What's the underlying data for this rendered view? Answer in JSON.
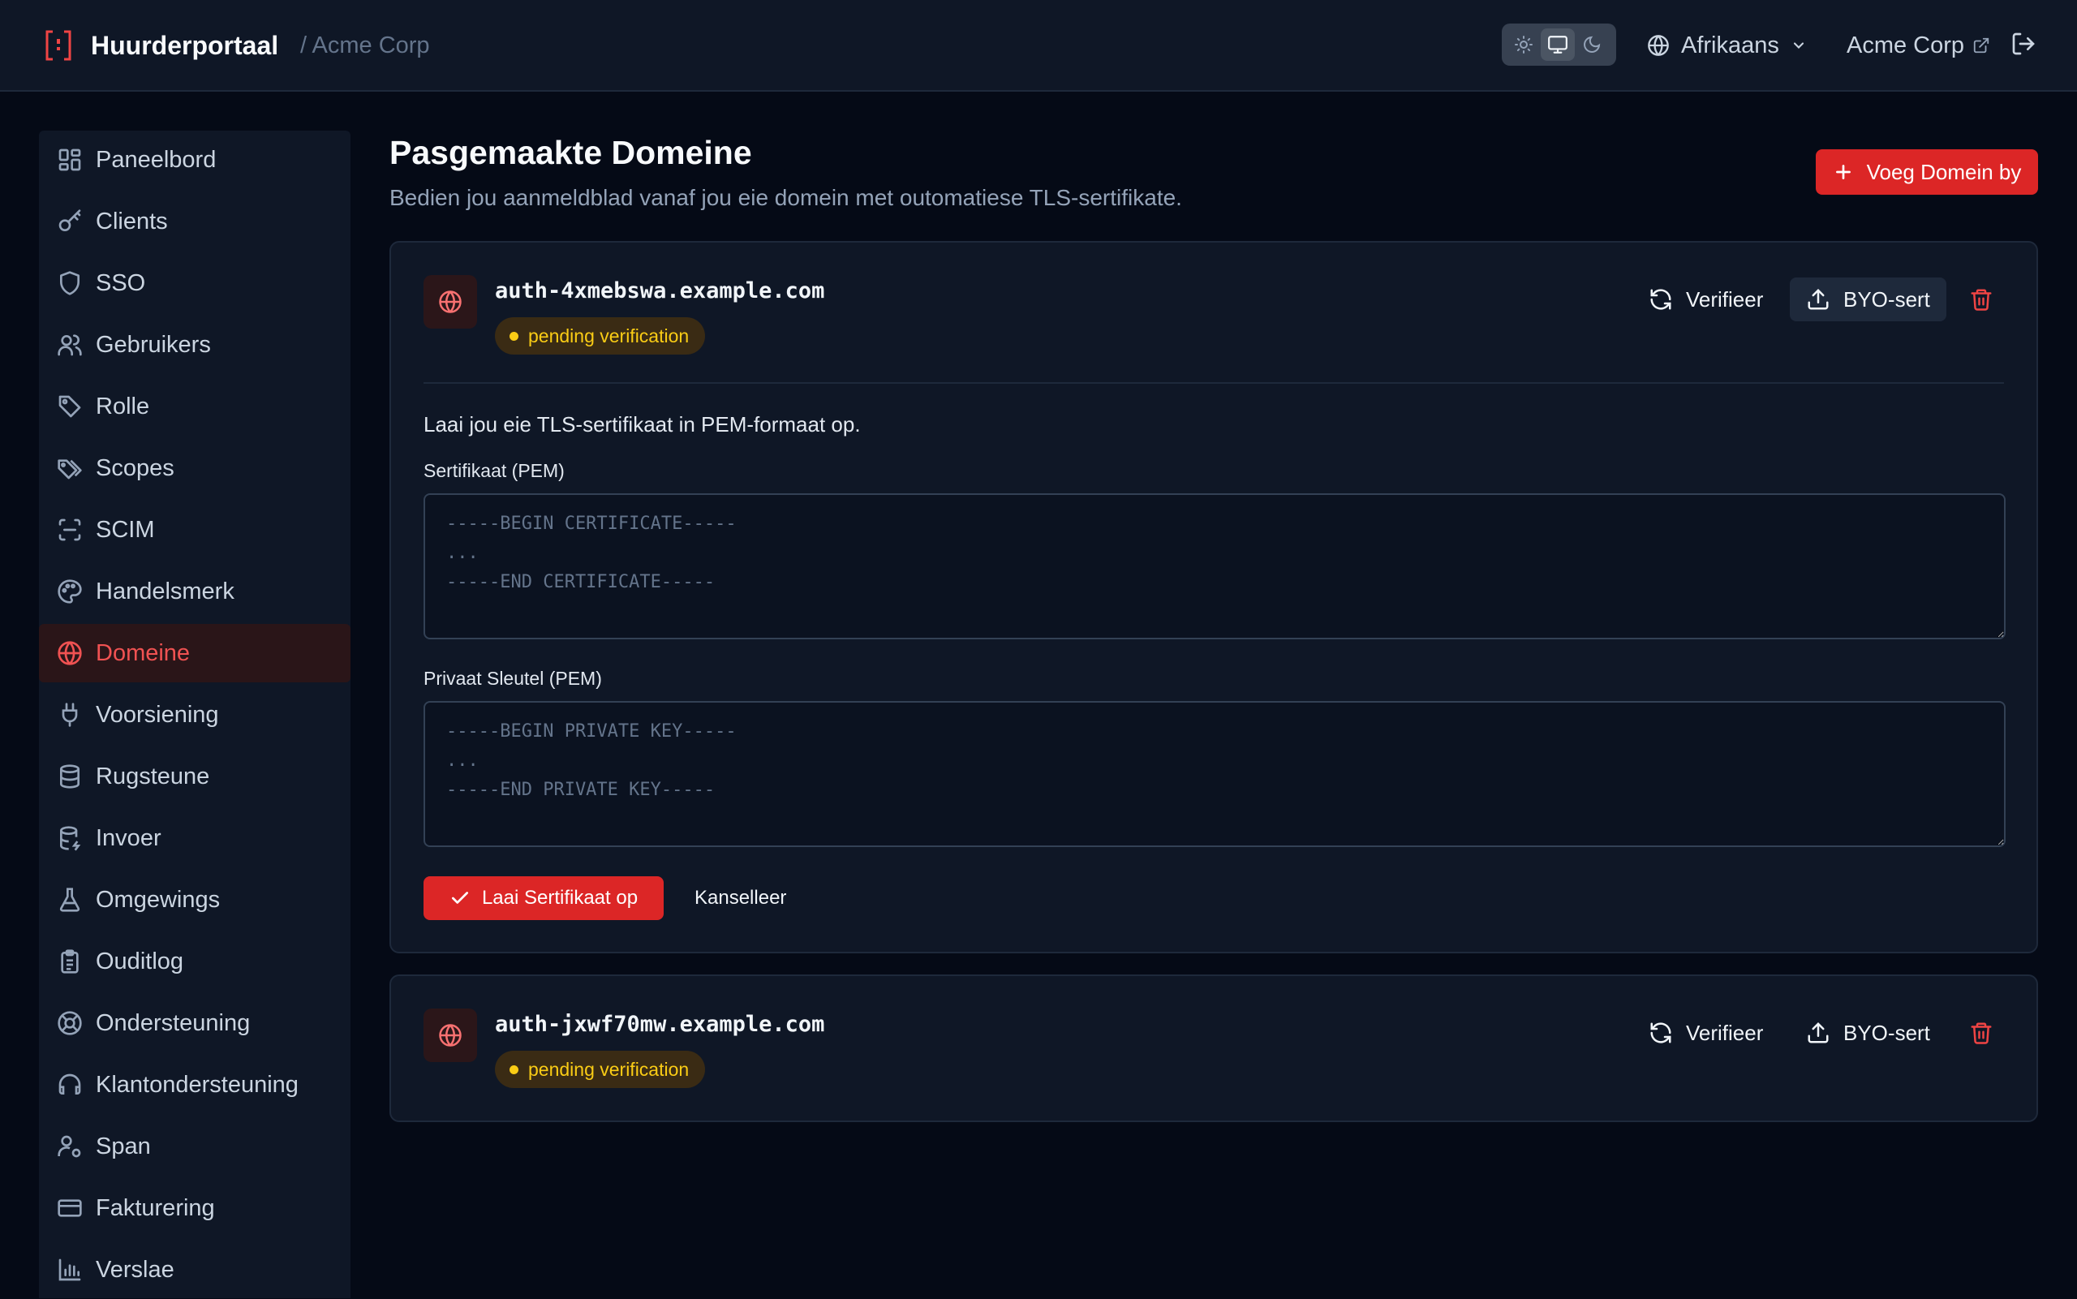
{
  "header": {
    "brand": "Huurderportaal",
    "breadcrumb": "/ Acme Corp",
    "language": "Afrikaans",
    "org_link": "Acme Corp"
  },
  "sidebar": {
    "items": [
      {
        "label": "Paneelbord",
        "icon": "dashboard-icon"
      },
      {
        "label": "Clients",
        "icon": "key-icon"
      },
      {
        "label": "SSO",
        "icon": "shield-icon"
      },
      {
        "label": "Gebruikers",
        "icon": "users-icon"
      },
      {
        "label": "Rolle",
        "icon": "tag-icon"
      },
      {
        "label": "Scopes",
        "icon": "tags-icon"
      },
      {
        "label": "SCIM",
        "icon": "scan-icon"
      },
      {
        "label": "Handelsmerk",
        "icon": "palette-icon"
      },
      {
        "label": "Domeine",
        "icon": "globe-icon",
        "active": true
      },
      {
        "label": "Voorsiening",
        "icon": "plug-icon"
      },
      {
        "label": "Rugsteune",
        "icon": "database-icon"
      },
      {
        "label": "Invoer",
        "icon": "database-import-icon"
      },
      {
        "label": "Omgewings",
        "icon": "flask-icon"
      },
      {
        "label": "Ouditlog",
        "icon": "clipboard-icon"
      },
      {
        "label": "Ondersteuning",
        "icon": "lifebuoy-icon"
      },
      {
        "label": "Klantondersteuning",
        "icon": "headset-icon"
      },
      {
        "label": "Span",
        "icon": "user-cog-icon"
      },
      {
        "label": "Fakturering",
        "icon": "credit-card-icon"
      },
      {
        "label": "Verslae",
        "icon": "bar-chart-icon"
      }
    ]
  },
  "main": {
    "title": "Pasgemaakte Domeine",
    "subtitle": "Bedien jou aanmeldblad vanaf jou eie domein met outomatiese TLS-sertifikate.",
    "add_button": "Voeg Domein by"
  },
  "domains": [
    {
      "name": "auth-4xmebswa.example.com",
      "status": "pending verification",
      "verify_label": "Verifieer",
      "byo_label": "BYO-sert",
      "expanded": true
    },
    {
      "name": "auth-jxwf70mw.example.com",
      "status": "pending verification",
      "verify_label": "Verifieer",
      "byo_label": "BYO-sert",
      "expanded": false
    }
  ],
  "upload_form": {
    "intro": "Laai jou eie TLS-sertifikaat in PEM-formaat op.",
    "cert_label": "Sertifikaat (PEM)",
    "cert_placeholder": "-----BEGIN CERTIFICATE-----\n...\n-----END CERTIFICATE-----",
    "key_label": "Privaat Sleutel (PEM)",
    "key_placeholder": "-----BEGIN PRIVATE KEY-----\n...\n-----END PRIVATE KEY-----",
    "submit_label": "Laai Sertifikaat op",
    "cancel_label": "Kanselleer"
  },
  "colors": {
    "accent": "#dc2626",
    "active_nav_text": "#f05252",
    "badge_text": "#facc15",
    "background": "#050a16",
    "panel": "#0f1726"
  }
}
